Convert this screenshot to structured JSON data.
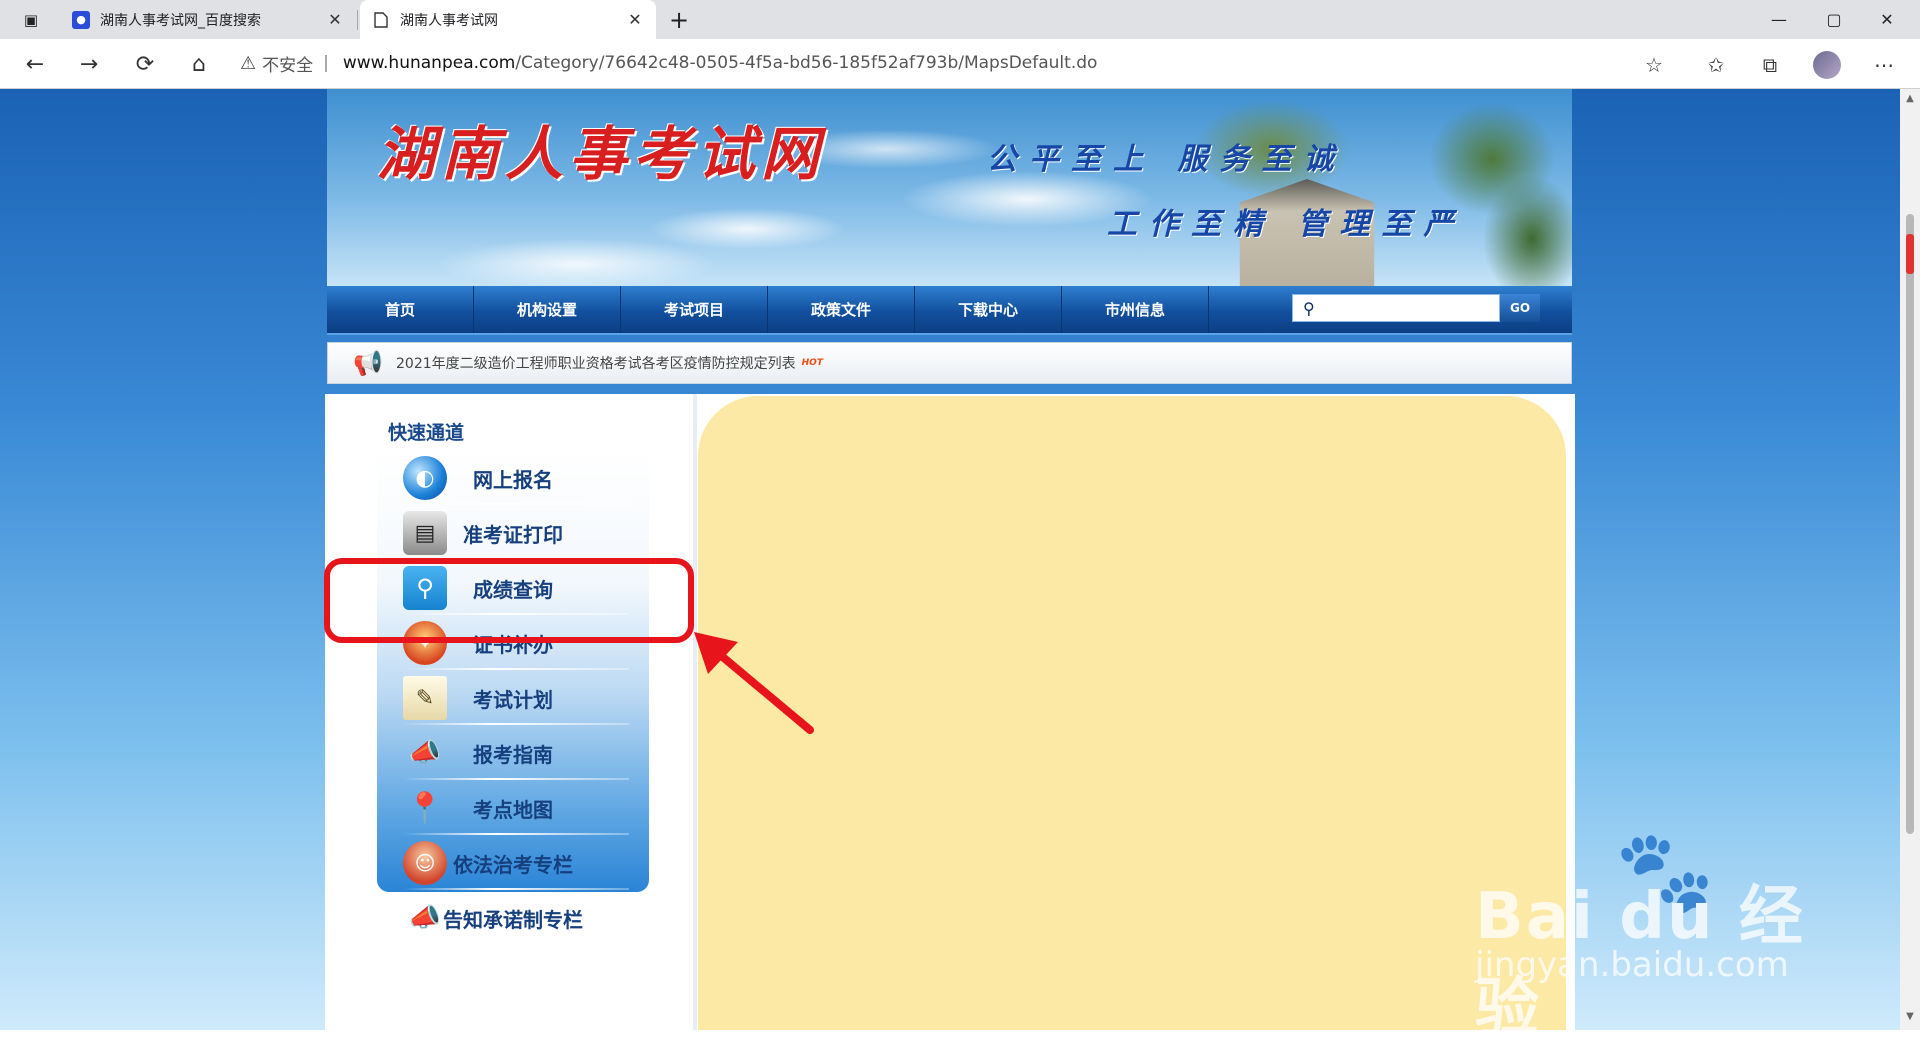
{
  "browser": {
    "tabs": [
      {
        "title": "湖南人事考试网_百度搜索",
        "active": false
      },
      {
        "title": "湖南人事考试网",
        "active": true
      }
    ],
    "new_tab": "+",
    "window_controls": {
      "minimize": "—",
      "maximize": "▢",
      "close": "✕"
    },
    "address": {
      "security_label": "不安全",
      "separator": "|",
      "url_host": "www.hunanpea.com",
      "url_path": "/Category/76642c48-0505-4f5a-bd56-185f52af793b/MapsDefault.do"
    },
    "icons": [
      "sidebar-icon",
      "back-icon",
      "forward-icon",
      "refresh-icon",
      "home-icon",
      "warning-icon",
      "add-favorite-icon",
      "favorites-icon",
      "collections-icon",
      "profile-avatar",
      "more-icon"
    ]
  },
  "site": {
    "logo_text": "湖南人事考试网",
    "slogan_line1": "公平至上 服务至诚",
    "slogan_line2": "工作至精 管理至严",
    "nav": [
      "首页",
      "机构设置",
      "考试项目",
      "政策文件",
      "下载中心",
      "市州信息"
    ],
    "search": {
      "placeholder": "",
      "go_label": "GO"
    },
    "news": {
      "text": "2021年度二级造价工程师职业资格考试各考区疫情防控规定列表",
      "badge": "HOT"
    }
  },
  "quick_access": {
    "title": "快速通道",
    "items": [
      {
        "label": "网上报名",
        "icon": "globe-icon"
      },
      {
        "label": "准考证打印",
        "icon": "printer-icon"
      },
      {
        "label": "成绩查询",
        "icon": "search-icon"
      },
      {
        "label": "证书补办",
        "icon": "certificate-icon"
      },
      {
        "label": "考试计划",
        "icon": "notepad-icon"
      },
      {
        "label": "报考指南",
        "icon": "megaphone-icon"
      },
      {
        "label": "考点地图",
        "icon": "map-pin-icon"
      },
      {
        "label": "依法治考专栏",
        "icon": "person-icon"
      },
      {
        "label": "告知承诺制专栏",
        "icon": "megaphone-icon"
      }
    ]
  },
  "annotation": {
    "highlight_color": "#e8141c",
    "highlighted_item": "成绩查询"
  },
  "watermark": {
    "main": "Bai du 经验",
    "sub": "jingyan.baidu.com"
  }
}
